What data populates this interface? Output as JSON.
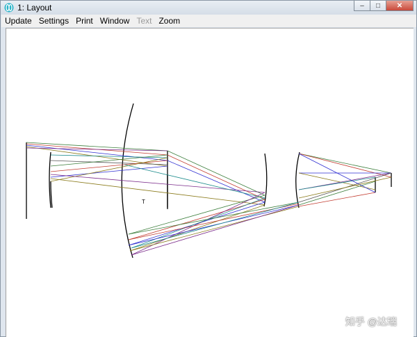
{
  "window": {
    "title": "1: Layout",
    "controls": {
      "minimize": "–",
      "maximize": "□",
      "close": "✕"
    }
  },
  "menubar": {
    "items": [
      {
        "label": "Update",
        "enabled": true
      },
      {
        "label": "Settings",
        "enabled": true
      },
      {
        "label": "Print",
        "enabled": true
      },
      {
        "label": "Window",
        "enabled": true
      },
      {
        "label": "Text",
        "enabled": false
      },
      {
        "label": "Zoom",
        "enabled": true
      }
    ]
  },
  "layout": {
    "surface_label": "T",
    "ray_colors": [
      "#3a7d3a",
      "#c23b2f",
      "#2d2dd1",
      "#8a7a1a",
      "#7a2a8a",
      "#1a8a8a",
      "#555555"
    ]
  },
  "watermark": "知乎 @达瑞"
}
